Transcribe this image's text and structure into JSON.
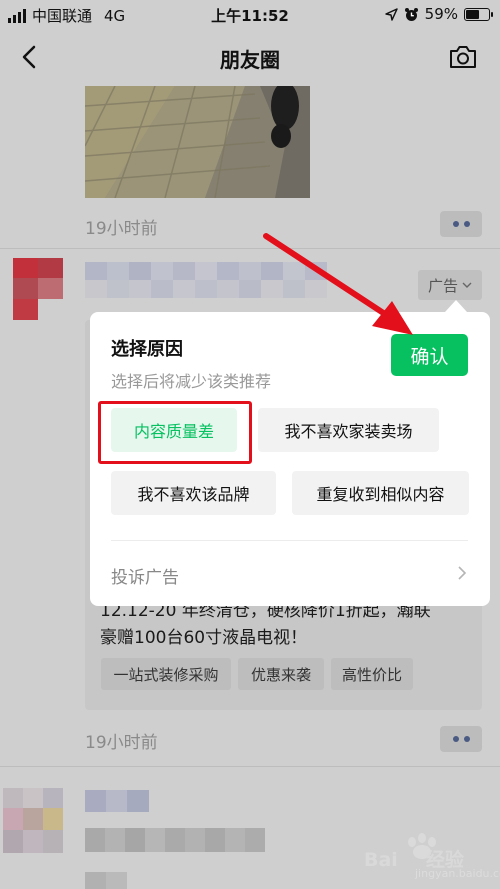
{
  "status_bar": {
    "carrier": "中国联通",
    "network": "4G",
    "time": "上午11:52",
    "battery": "59%",
    "battery_level": 0.59
  },
  "nav": {
    "title": "朋友圈"
  },
  "feed": {
    "post1_time": "19小时前",
    "ad_tag_label": "广告",
    "ad_text_partial": "12.12-20 年终清仓，硬核降价1折起，瀚联",
    "ad_text_line2": "豪赠100台60寸液晶电视！",
    "ad_tags": [
      "一站式装修采购",
      "优惠来袭",
      "高性价比"
    ],
    "post2_time": "19小时前"
  },
  "popup": {
    "title": "选择原因",
    "subtitle": "选择后将减少该类推荐",
    "confirm_label": "确认",
    "reasons": [
      "内容质量差",
      "我不喜欢家装卖场",
      "我不喜欢该品牌",
      "重复收到相似内容"
    ],
    "selected_reason": "内容质量差",
    "complain_label": "投诉广告"
  },
  "colors": {
    "accent": "#07c160",
    "annotation_red": "#e3101b",
    "link_blue": "#4a5a83"
  },
  "watermark": {
    "brand": "Bai",
    "brand2": "经验",
    "domain": "jingyan.baidu.com"
  }
}
